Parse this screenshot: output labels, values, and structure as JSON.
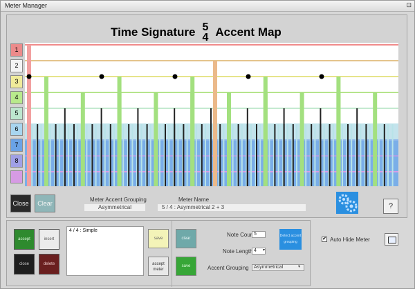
{
  "window": {
    "title": "Meter Manager",
    "sys_btn": "⊡"
  },
  "heading": {
    "prefix": "Time Signature",
    "numerator": "5",
    "denominator": "4",
    "suffix": "Accent Map"
  },
  "rows": [
    {
      "label": "1",
      "color": "#ec8b8b"
    },
    {
      "label": "2",
      "color": "#f4f4f4"
    },
    {
      "label": "3",
      "color": "#f0eb9a"
    },
    {
      "label": "4",
      "color": "#b8ea8c"
    },
    {
      "label": "5",
      "color": "#bde7cf"
    },
    {
      "label": "6",
      "color": "#a8d5ef"
    },
    {
      "label": "7",
      "color": "#6aa2e6"
    },
    {
      "label": "8",
      "color": "#a0a0e6"
    },
    {
      "label": "",
      "color": "#d69be4"
    }
  ],
  "buttons": {
    "close": "Close",
    "clear": "Clear",
    "help": "?"
  },
  "meter_accent_grouping": {
    "label": "Meter Accent Grouping",
    "value": "Asymmetrical"
  },
  "meter_name": {
    "label": "Meter Name",
    "value": "5 / 4 : Asymmetrical 2 + 3"
  },
  "bottom": {
    "list_item": "4 / 4 : Simple",
    "btn_accept": "accept",
    "btn_insert": "insert",
    "btn_close": "close",
    "btn_delete": "delete",
    "btn_save": "save",
    "btn_accept_meter": "accept meter",
    "btn_clear": "clear",
    "btn_save2": "save",
    "note_count_label": "Note Count",
    "note_count_value": "5",
    "note_length_label": "Note Length",
    "note_length_value": "4",
    "accent_grouping_label": "Accent Grouping",
    "accent_grouping_value": "Asymmetrical",
    "blue_label": "Detect accent grouping"
  },
  "auto_hide": {
    "label": "Auto Hide Meter",
    "checked": "✔"
  },
  "colors": {
    "red": "#f2a0a0",
    "orange": "#ebb98a",
    "green": "#a3e07f",
    "cyan": "#b8e3e8",
    "blue": "#6aa2e6",
    "purple": "#c58be0",
    "dark": "#222222"
  }
}
